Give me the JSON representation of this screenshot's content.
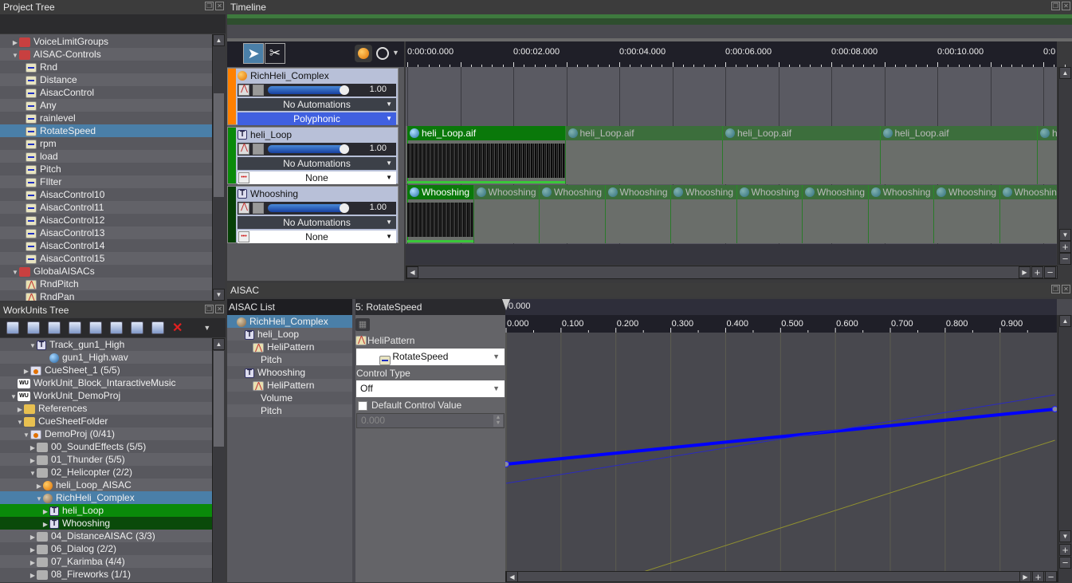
{
  "project_tree": {
    "title": "Project Tree",
    "items": [
      {
        "label": "VoiceLimitGroups",
        "icon": "folder-red-icon",
        "indent": 1,
        "toggle": "collapsed"
      },
      {
        "label": "AISAC-Controls",
        "icon": "folder-red-open-icon",
        "indent": 1,
        "toggle": "expanded"
      },
      {
        "label": "Rnd",
        "icon": "aisac-control-icon",
        "indent": 2
      },
      {
        "label": "Distance",
        "icon": "aisac-control-icon",
        "indent": 2
      },
      {
        "label": "AisacControl",
        "icon": "aisac-control-icon",
        "indent": 2
      },
      {
        "label": "Any",
        "icon": "aisac-control-icon",
        "indent": 2
      },
      {
        "label": "rainlevel",
        "icon": "aisac-control-icon",
        "indent": 2
      },
      {
        "label": "RotateSpeed",
        "icon": "aisac-control-icon",
        "indent": 2,
        "selected": true
      },
      {
        "label": "rpm",
        "icon": "aisac-control-icon",
        "indent": 2
      },
      {
        "label": "load",
        "icon": "aisac-control-icon",
        "indent": 2
      },
      {
        "label": "Pitch",
        "icon": "aisac-control-icon",
        "indent": 2
      },
      {
        "label": "FIlter",
        "icon": "aisac-control-icon",
        "indent": 2
      },
      {
        "label": "AisacControl10",
        "icon": "aisac-control-icon",
        "indent": 2
      },
      {
        "label": "AisacControl11",
        "icon": "aisac-control-icon",
        "indent": 2
      },
      {
        "label": "AisacControl12",
        "icon": "aisac-control-icon",
        "indent": 2
      },
      {
        "label": "AisacControl13",
        "icon": "aisac-control-icon",
        "indent": 2
      },
      {
        "label": "AisacControl14",
        "icon": "aisac-control-icon",
        "indent": 2
      },
      {
        "label": "AisacControl15",
        "icon": "aisac-control-icon",
        "indent": 2
      },
      {
        "label": "GlobalAISACs",
        "icon": "folder-red-open-icon",
        "indent": 1,
        "toggle": "expanded"
      },
      {
        "label": "RndPitch",
        "icon": "aisac-graph-icon",
        "indent": 2
      },
      {
        "label": "RndPan",
        "icon": "aisac-graph-icon",
        "indent": 2
      }
    ]
  },
  "workunits_tree": {
    "title": "WorkUnits Tree",
    "toolbar": [
      "new-track-icon",
      "new-track-2-icon",
      "new-track-3-icon",
      "new-block-icon",
      "new-marker-icon",
      "new-aisac-icon",
      "new-action-icon",
      "new-sequence-icon",
      "delete-icon",
      "more-dropdown-icon"
    ],
    "items": [
      {
        "label": "Track_gun1_High",
        "icon": "track-icon",
        "indent": 4,
        "toggle": "expanded"
      },
      {
        "label": "gun1_High.wav",
        "icon": "waveform-icon",
        "indent": 6
      },
      {
        "label": "CueSheet_1 (5/5)",
        "icon": "cuesheet-icon",
        "indent": 3,
        "toggle": "collapsed"
      },
      {
        "label": "WorkUnit_Block_IntaractiveMusic",
        "icon": "workunit-icon",
        "indent": 1
      },
      {
        "label": "WorkUnit_DemoProj",
        "icon": "workunit-icon",
        "indent": 1,
        "toggle": "expanded"
      },
      {
        "label": "References",
        "icon": "folder-yellow-icon",
        "indent": 2,
        "toggle": "collapsed"
      },
      {
        "label": "CueSheetFolder",
        "icon": "folder-yellow-open-icon",
        "indent": 2,
        "toggle": "expanded"
      },
      {
        "label": "DemoProj (0/41)",
        "icon": "cuesheet-icon",
        "indent": 3,
        "toggle": "expanded"
      },
      {
        "label": "00_SoundEffects (5/5)",
        "icon": "folder-gray-icon",
        "indent": 4,
        "toggle": "collapsed"
      },
      {
        "label": "01_Thunder (5/5)",
        "icon": "folder-gray-icon",
        "indent": 4,
        "toggle": "collapsed"
      },
      {
        "label": "02_Helicopter (2/2)",
        "icon": "folder-gray-open-icon",
        "indent": 4,
        "toggle": "expanded"
      },
      {
        "label": "heli_Loop_AISAC",
        "icon": "cue-orb-icon",
        "indent": 5,
        "toggle": "collapsed"
      },
      {
        "label": "RichHeli_Complex",
        "icon": "cue-orb-gray-icon",
        "indent": 5,
        "toggle": "expanded",
        "selected": true
      },
      {
        "label": "heli_Loop",
        "icon": "track-icon",
        "indent": 6,
        "toggle": "collapsed",
        "highlight": "green"
      },
      {
        "label": "Whooshing",
        "icon": "track-icon",
        "indent": 6,
        "toggle": "collapsed",
        "highlight": "darkgreen"
      },
      {
        "label": "04_DistanceAISAC (3/3)",
        "icon": "folder-gray-icon",
        "indent": 4,
        "toggle": "collapsed"
      },
      {
        "label": "06_Dialog (2/2)",
        "icon": "folder-gray-icon",
        "indent": 4,
        "toggle": "collapsed"
      },
      {
        "label": "07_Karimba (4/4)",
        "icon": "folder-gray-icon",
        "indent": 4,
        "toggle": "collapsed"
      },
      {
        "label": "08_Fireworks (1/1)",
        "icon": "folder-gray-icon",
        "indent": 4,
        "toggle": "collapsed"
      }
    ]
  },
  "timeline": {
    "title": "Timeline",
    "tools": {
      "select": "select-tool",
      "cut": "cut-tool"
    },
    "ruler_labels": [
      "0:00:00.000",
      "0:00:02.000",
      "0:00:04.000",
      "0:00:06.000",
      "0:00:08.000",
      "0:00:10.000",
      "0:0"
    ],
    "tracks": [
      {
        "name": "RichHeli_Complex",
        "type": "cue",
        "color": "#ff8000",
        "volume": "1.00",
        "volume_fraction": 1.0,
        "automation": "No Automations",
        "mode": "Polyphonic"
      },
      {
        "name": "heli_Loop",
        "type": "track",
        "color": "#0a8a0a",
        "volume": "1.00",
        "volume_fraction": 1.0,
        "automation": "No Automations",
        "mode": "None",
        "clip_label": "heli_Loop.aif",
        "clip_count": 5
      },
      {
        "name": "Whooshing",
        "type": "track",
        "color": "#064006",
        "volume": "1.00",
        "volume_fraction": 1.0,
        "automation": "No Automations",
        "mode": "None",
        "clip_label": "Whooshing",
        "clip_count": 10
      }
    ]
  },
  "aisac": {
    "title": "AISAC",
    "list_title": "AISAC List",
    "list_items": [
      {
        "label": "RichHeli_Complex",
        "icon": "cue-orb-gray-icon",
        "indent": 0,
        "selected": true
      },
      {
        "label": "heli_Loop",
        "icon": "track-icon",
        "indent": 1
      },
      {
        "label": "HeliPattern",
        "icon": "aisac-graph-icon",
        "indent": 2
      },
      {
        "label": "Pitch",
        "icon": "",
        "indent": 3
      },
      {
        "label": "Whooshing",
        "icon": "track-icon",
        "indent": 1
      },
      {
        "label": "HeliPattern",
        "icon": "aisac-graph-icon",
        "indent": 2
      },
      {
        "label": "Volume",
        "icon": "",
        "indent": 3
      },
      {
        "label": "Pitch",
        "icon": "",
        "indent": 3
      }
    ],
    "props": {
      "header": "5: RotateSpeed",
      "aisac_name": "HeliPattern",
      "control_select": "RotateSpeed",
      "control_type_label": "Control Type",
      "control_type_value": "Off",
      "default_value_label": "Default Control Value",
      "default_value_checked": false,
      "default_value": "0.000"
    },
    "cursor_value": "0.000"
  },
  "chart_data": {
    "type": "line",
    "title": "",
    "xlabel": "",
    "ylabel": "",
    "xlim": [
      0,
      1
    ],
    "ylim": [
      0,
      1
    ],
    "x_ticks": [
      "0.000",
      "0.100",
      "0.200",
      "0.300",
      "0.400",
      "0.500",
      "0.600",
      "0.700",
      "0.800",
      "0.900"
    ],
    "grid": true,
    "series": [
      {
        "name": "RotateSpeed curve (selected)",
        "color": "#0000ff",
        "points": [
          [
            0.0,
            0.45
          ],
          [
            1.0,
            0.68
          ]
        ]
      },
      {
        "name": "Reference curve (blue thin)",
        "color": "#2a2ac0",
        "points": [
          [
            0.0,
            0.37
          ],
          [
            1.0,
            0.74
          ]
        ]
      },
      {
        "name": "Reference curve (yellow)",
        "color": "#909030",
        "points": [
          [
            0.0,
            0.0
          ],
          [
            0.25,
            0.0
          ],
          [
            1.0,
            0.55
          ]
        ]
      }
    ]
  }
}
